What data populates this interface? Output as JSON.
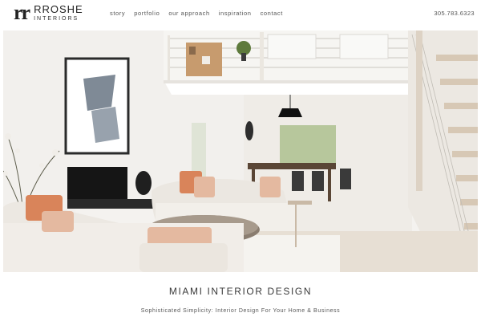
{
  "brand": {
    "mark": "rr",
    "name": "RROSHE",
    "sub": "INTERIORS"
  },
  "nav": {
    "items": [
      {
        "label": "story"
      },
      {
        "label": "portfolio"
      },
      {
        "label": "our approach"
      },
      {
        "label": "inspiration"
      },
      {
        "label": "contact"
      }
    ]
  },
  "phone": "305.783.6323",
  "hero": {
    "subject": "living-room-photo"
  },
  "caption": {
    "title": "MIAMI INTERIOR DESIGN",
    "subtitle": "Sophisticated Simplicity: Interior Design For Your Home & Business"
  },
  "colors": {
    "background": "#ffffff",
    "text": "#333333",
    "accent_pillow": "#d9845a"
  }
}
